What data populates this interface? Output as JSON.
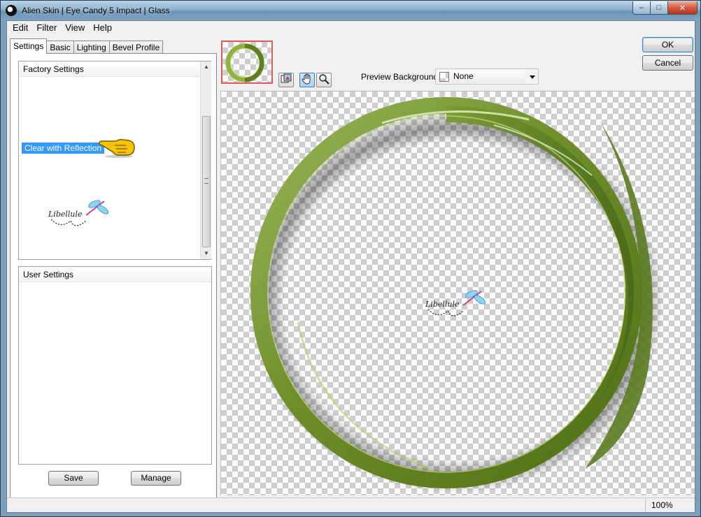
{
  "window": {
    "title": "Alien Skin | Eye Candy 5 Impact | Glass",
    "minimize": "–",
    "maximize": "□",
    "close": "✕"
  },
  "menu": [
    "Edit",
    "Filter",
    "View",
    "Help"
  ],
  "tabs": [
    "Settings",
    "Basic",
    "Lighting",
    "Bevel Profile"
  ],
  "active_tab": "Settings",
  "factory_settings": {
    "header": "Factory Settings",
    "selected_item": "Clear with Reflection"
  },
  "user_settings": {
    "header": "User Settings"
  },
  "buttons": {
    "save": "Save",
    "manage": "Manage",
    "ok": "OK",
    "cancel": "Cancel"
  },
  "toolbar": {
    "tools": [
      {
        "icon": "preview-compare-icon"
      },
      {
        "icon": "hand-pan-icon",
        "active": true
      },
      {
        "icon": "zoom-magnifier-icon"
      }
    ]
  },
  "preview_background": {
    "label": "Preview Background:",
    "value": "None"
  },
  "watermark": {
    "text": "Libellule"
  },
  "status": {
    "zoom": "100%"
  },
  "colors": {
    "selection": "#3399ff",
    "ring_green": "#6f8e2a",
    "ring_light": "#b5cc6a",
    "title_bar": "#8cb0cc",
    "ok_border": "#3c7fb1",
    "thumbnail_border": "#e05a5a"
  }
}
